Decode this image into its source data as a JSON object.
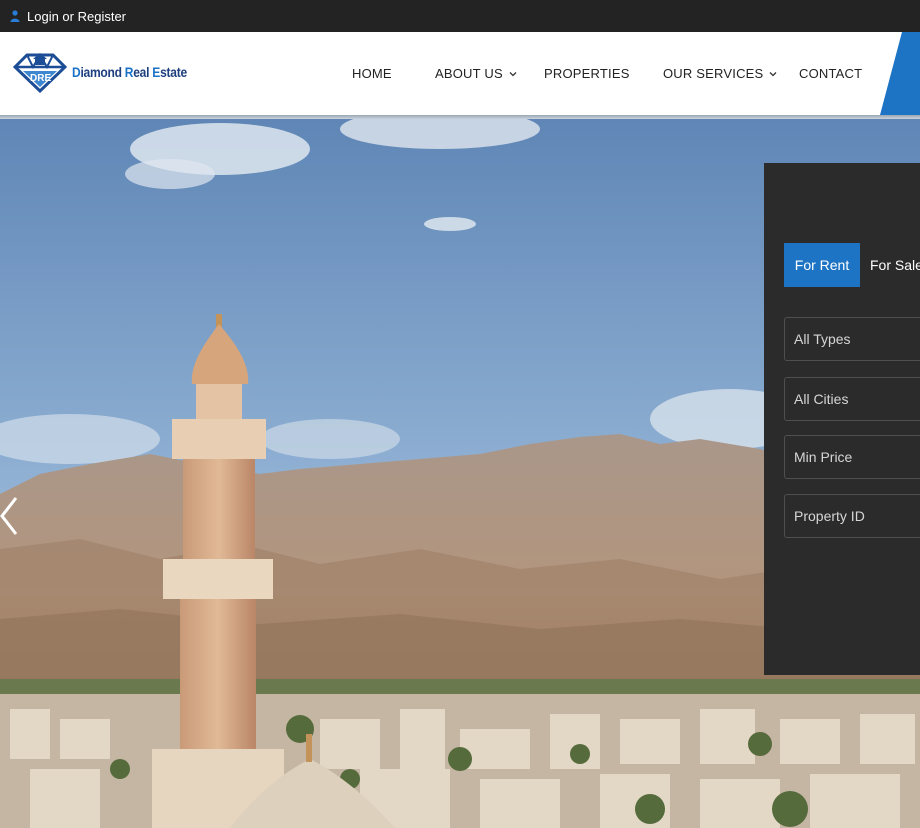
{
  "topbar": {
    "login_label": "Login or Register",
    "icon": "user-icon"
  },
  "header": {
    "logo": {
      "text_parts": [
        "D",
        "iamond ",
        "R",
        "eal ",
        "E",
        "state"
      ],
      "icon": "diamond-logo-icon"
    },
    "nav": [
      {
        "label": "HOME",
        "has_dropdown": false
      },
      {
        "label": "ABOUT US",
        "has_dropdown": true
      },
      {
        "label": "PROPERTIES",
        "has_dropdown": false
      },
      {
        "label": "OUR SERVICES",
        "has_dropdown": true
      },
      {
        "label": "CONTACT",
        "has_dropdown": false
      }
    ]
  },
  "hero": {
    "prev_icon": "chevron-left-icon"
  },
  "search": {
    "tabs": [
      {
        "label": "For Rent",
        "active": true
      },
      {
        "label": "For Sale",
        "active": false
      }
    ],
    "fields": {
      "type": "All Types",
      "city": "All Cities",
      "min_price": "Min Price",
      "property_id": "Property ID"
    }
  },
  "colors": {
    "accent": "#1d73c4",
    "topbar": "#232323",
    "panel": "#2b2b2b",
    "brand_dark": "#1d3f7e"
  }
}
